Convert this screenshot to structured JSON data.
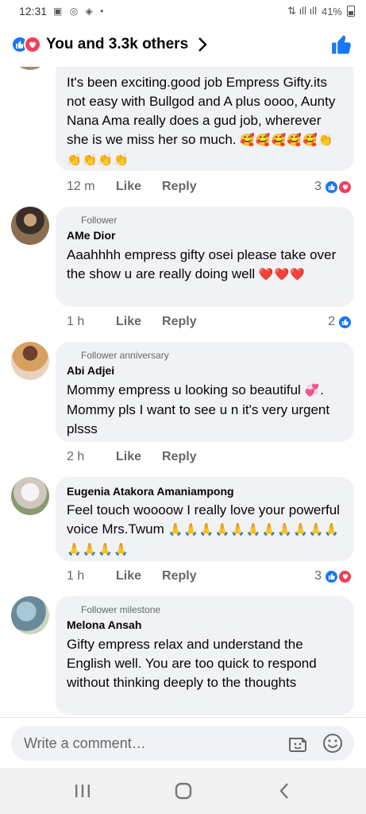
{
  "status_bar": {
    "time": "12:31",
    "battery": "41%"
  },
  "header": {
    "title": "You and 3.3k others"
  },
  "comments": [
    {
      "text": "It's been exciting.good job Empress Gifty.its not easy with Bullgod and A plus oooo, Aunty Nana Ama really does a gud job, wherever she is we miss her so much.",
      "emoji": "🥰🥰🥰🥰🥰👏👏👏👏👏",
      "time": "12 m",
      "like": "Like",
      "reply": "Reply",
      "reaction_count": "3"
    },
    {
      "badge": "Follower",
      "name": "AMe Dior",
      "text": "Aaahhhh empress gifty osei please take over the show u are really doing well",
      "emoji": "❤️❤️❤️",
      "time": "1 h",
      "like": "Like",
      "reply": "Reply",
      "reaction_count": "2"
    },
    {
      "badge": "Follower anniversary",
      "name": "Abi Adjei",
      "text": "Mommy empress u looking so beautiful",
      "emoji": "💞",
      "text2": ". Mommy pls I want to see u n it's very urgent plsss",
      "time": "2 h",
      "like": "Like",
      "reply": "Reply"
    },
    {
      "name": "Eugenia Atakora Amaniampong",
      "text": "Feel touch woooow I really love your powerful voice Mrs.Twum",
      "emoji": "🙏🙏🙏🙏🙏🙏🙏🙏🙏🙏🙏🙏🙏🙏🙏",
      "time": "1 h",
      "like": "Like",
      "reply": "Reply",
      "reaction_count": "3"
    },
    {
      "badge": "Follower milestone",
      "name": "Melona Ansah",
      "text": "Gifty empress relax and understand the English well. You are too quick to respond without thinking deeply to the thoughts"
    }
  ],
  "composer": {
    "placeholder": "Write a comment…"
  },
  "colors": {
    "facebook_blue": "#1877f2",
    "love_red": "#f33e58",
    "bubble_gray": "#f0f2f5",
    "meta_gray": "#65676b"
  },
  "icons": [
    "like-reaction-icon",
    "love-reaction-icon",
    "chevron-right-icon",
    "thumbs-up-icon",
    "sticker-icon",
    "emoji-icon",
    "recent-apps-icon",
    "home-icon",
    "back-icon"
  ]
}
